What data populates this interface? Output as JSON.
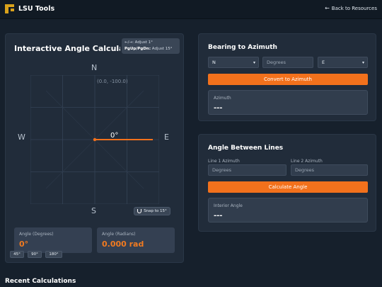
{
  "app": {
    "title": "LSU Tools",
    "back_link": "Back to Resources"
  },
  "calculator": {
    "title": "Interactive Angle Calculator",
    "hint_line1": "←/→: Adjust 1°",
    "hint_key2": "PgUp/PgDn:",
    "hint_line2": "Adjust 15°",
    "compass": {
      "n": "N",
      "s": "S",
      "w": "W",
      "e": "E"
    },
    "coordinate": "(0.0, -100.0)",
    "angle": "0°",
    "snap_label": "Snap to 15°",
    "degrees_label": "Angle (Degrees)",
    "degrees_value": "0°",
    "radians_label": "Angle (Radians)",
    "radians_value": "0.000 rad",
    "quick": [
      "45°",
      "90°",
      "180°"
    ]
  },
  "bearing": {
    "title": "Bearing to Azimuth",
    "dir1": "N",
    "degrees_placeholder": "Degrees",
    "dir2": "E",
    "button": "Convert to Azimuth",
    "result_label": "Azimuth",
    "result_value": "---"
  },
  "between": {
    "title": "Angle Between Lines",
    "line1_label": "Line 1 Azimuth",
    "line1_placeholder": "Degrees",
    "line2_label": "Line 2 Azimuth",
    "line2_placeholder": "Degrees",
    "button": "Calculate Angle",
    "result_label": "Interior Angle",
    "result_value": "---"
  },
  "recent": {
    "title": "Recent Calculations"
  },
  "colors": {
    "accent": "#f2711c",
    "background": "#16202c",
    "panel": "#212c3a"
  }
}
